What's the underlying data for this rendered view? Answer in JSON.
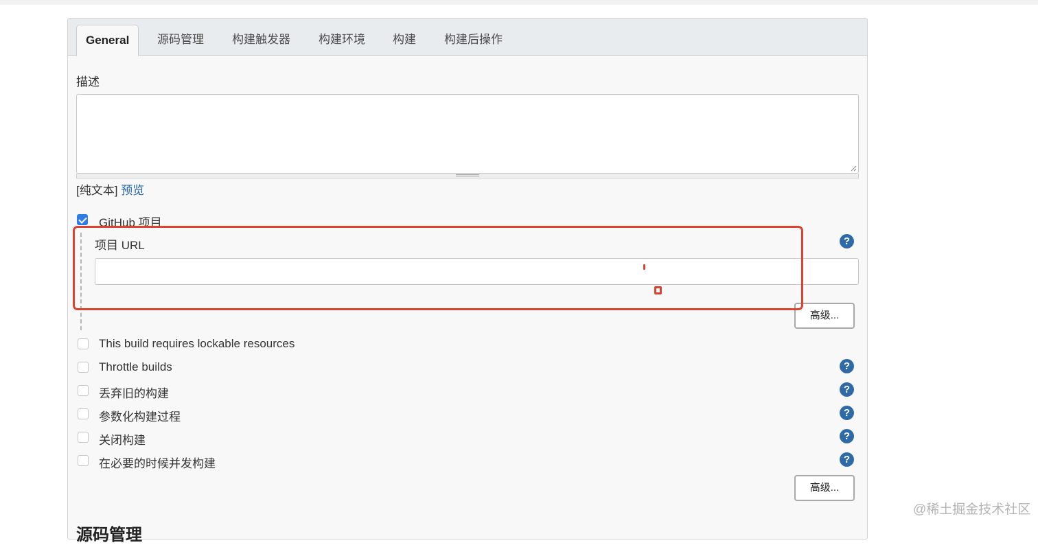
{
  "tabs": [
    {
      "label": "General",
      "active": true
    },
    {
      "label": "源码管理"
    },
    {
      "label": "构建触发器"
    },
    {
      "label": "构建环境"
    },
    {
      "label": "构建"
    },
    {
      "label": "构建后操作"
    }
  ],
  "description": {
    "label": "描述",
    "value": "",
    "plain_text": "[纯文本]",
    "preview": "预览"
  },
  "github": {
    "checkbox_label": "GitHub 项目",
    "checked": true,
    "url_label": "项目 URL",
    "url_value": "",
    "advanced_label": "高级..."
  },
  "options": [
    {
      "label": "This build requires lockable resources",
      "checked": false,
      "help": false
    },
    {
      "label": "Throttle builds",
      "checked": false,
      "help": true
    },
    {
      "label": "丢弃旧的构建",
      "checked": false,
      "help": true
    },
    {
      "label": "参数化构建过程",
      "checked": false,
      "help": true
    },
    {
      "label": "关闭构建",
      "checked": false,
      "help": true
    },
    {
      "label": "在必要的时候并发构建",
      "checked": false,
      "help": true
    }
  ],
  "advanced2_label": "高级...",
  "help_glyph": "?",
  "next_section_title": "源码管理",
  "watermark": "@稀土掘金技术社区",
  "colors": {
    "accent_blue": "#2f7ce8",
    "help_blue": "#2f6aa8",
    "link_blue": "#1d5fa8",
    "highlight_red": "#d9432f"
  }
}
